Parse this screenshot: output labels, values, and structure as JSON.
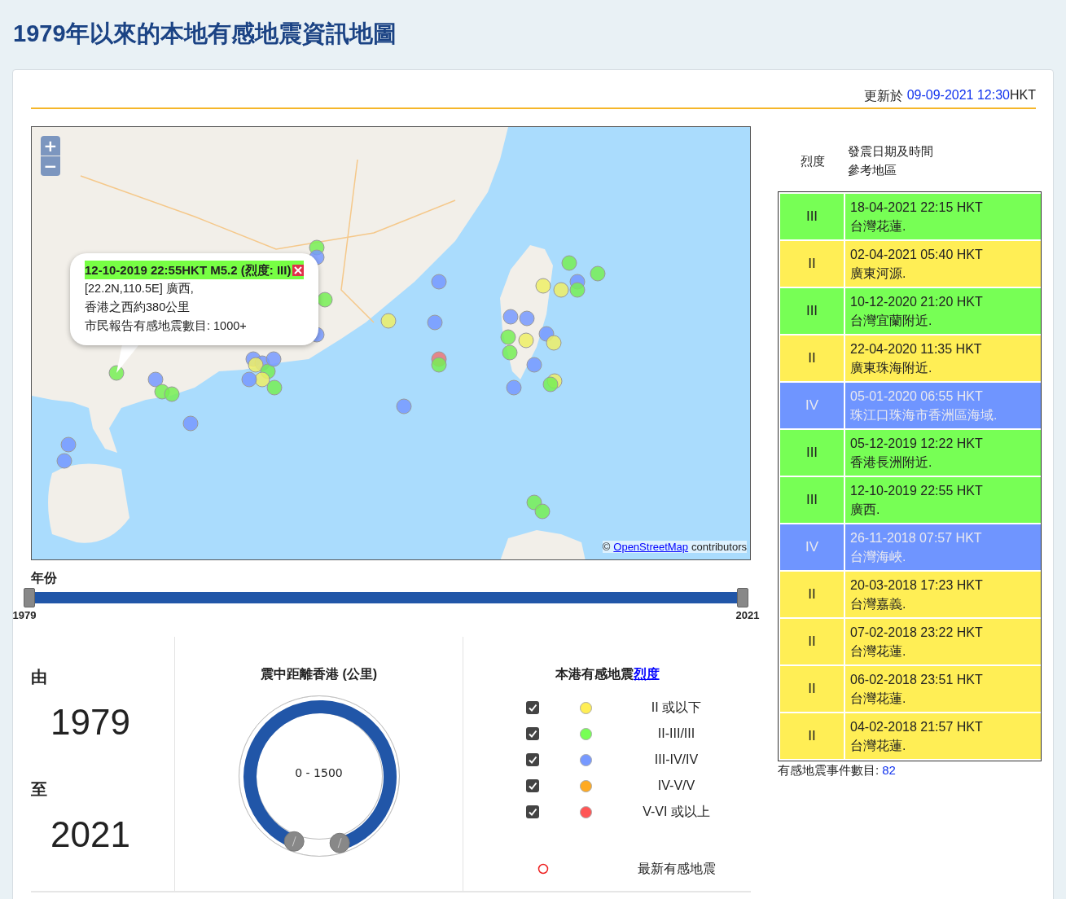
{
  "page_title": "1979年以來的本地有感地震資訊地圖",
  "update": {
    "label": "更新於",
    "datetime": "09-09-2021 12:30",
    "suffix": "HKT"
  },
  "map": {
    "zoom_in": "+",
    "zoom_out": "−",
    "popup": {
      "title": "12-10-2019 22:55HKT M5.2 (烈度: III)",
      "lines": [
        "[22.2N,110.5E] 廣西,",
        "香港之西約380公里",
        "市民報告有感地震數目: 1000+"
      ]
    },
    "attribution": {
      "symbol": "©",
      "link": "OpenStreetMap",
      "text": "contributors"
    }
  },
  "year_slider": {
    "label": "年份",
    "handles": [
      {
        "label": "1979",
        "level": 0
      },
      {
        "label": "2021",
        "level": 1
      }
    ]
  },
  "period": {
    "from_label": "由",
    "from": "1979",
    "to_label": "至",
    "to": "2021"
  },
  "distance": {
    "title": "震中距離香港 (公里)",
    "range": "0 - 1500",
    "level": 1
  },
  "intensity_legend": {
    "title": "本港有感地震",
    "link": "烈度",
    "items": [
      {
        "label": "II 或以下",
        "color": "#ffee55",
        "checked": true
      },
      {
        "label": "II-III/III",
        "color": "#77ff55",
        "checked": true
      },
      {
        "label": "III-IV/IV",
        "color": "#7799ff",
        "checked": true
      },
      {
        "label": "IV-V/V",
        "color": "#ffaa22",
        "checked": true
      },
      {
        "label": "V-VI 或以上",
        "color": "#ff5555",
        "checked": true
      }
    ],
    "latest": {
      "label": "最新有感地震"
    }
  },
  "events_table": {
    "columns": [
      "烈度",
      "發震日期及時間",
      "參考地區"
    ],
    "rows": [
      {
        "intensity": "III",
        "datetime": "18-04-2021 22:15 HKT",
        "place": "台灣花蓮.",
        "color": "#77ff55"
      },
      {
        "intensity": "II",
        "datetime": "02-04-2021 05:40 HKT",
        "place": "廣東河源.",
        "color": "#ffee55"
      },
      {
        "intensity": "III",
        "datetime": "10-12-2020 21:20 HKT",
        "place": "台灣宜蘭附近.",
        "color": "#77ff55"
      },
      {
        "intensity": "II",
        "datetime": "22-04-2020 11:35 HKT",
        "place": "廣東珠海附近.",
        "color": "#ffee55"
      },
      {
        "intensity": "IV",
        "datetime": "05-01-2020 06:55 HKT",
        "place": "珠江口珠海市香洲區海域.",
        "color": "#6f95ff"
      },
      {
        "intensity": "III",
        "datetime": "05-12-2019 12:22 HKT",
        "place": "香港長洲附近.",
        "color": "#77ff55"
      },
      {
        "intensity": "III",
        "datetime": "12-10-2019 22:55 HKT",
        "place": "廣西.",
        "color": "#77ff55"
      },
      {
        "intensity": "IV",
        "datetime": "26-11-2018 07:57 HKT",
        "place": "台灣海峽.",
        "color": "#6f95ff"
      },
      {
        "intensity": "II",
        "datetime": "20-03-2018 17:23 HKT",
        "place": "台灣嘉義.",
        "color": "#ffee55"
      },
      {
        "intensity": "II",
        "datetime": "07-02-2018 23:22 HKT",
        "place": "台灣花蓮.",
        "color": "#ffee55"
      },
      {
        "intensity": "II",
        "datetime": "06-02-2018 23:51 HKT",
        "place": "台灣花蓮.",
        "color": "#ffee55"
      },
      {
        "intensity": "II",
        "datetime": "04-02-2018 21:57 HKT",
        "place": "台灣花蓮.",
        "color": "#ffee55"
      }
    ],
    "count_label": "有感地震事件數目:",
    "count": "82"
  }
}
